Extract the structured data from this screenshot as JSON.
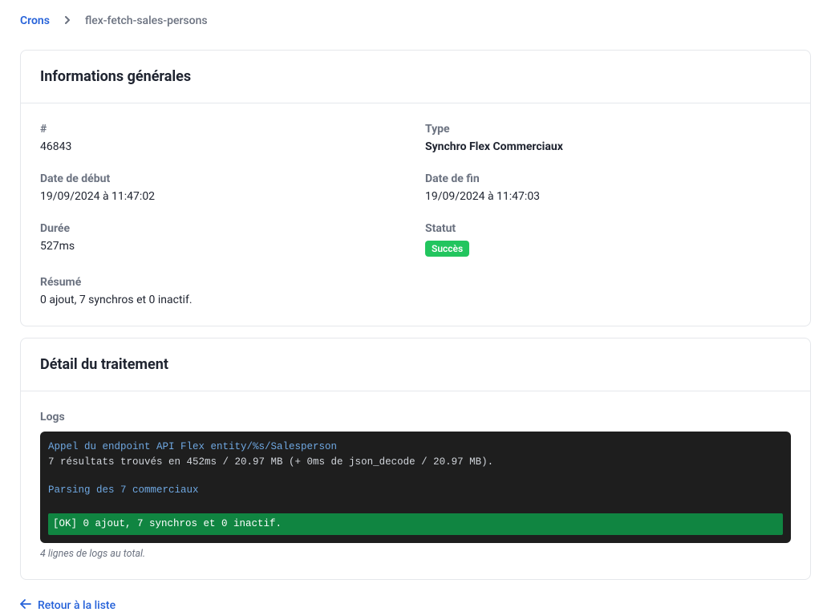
{
  "breadcrumb": {
    "root": "Crons",
    "current": "flex-fetch-sales-persons"
  },
  "card_general": {
    "title": "Informations générales",
    "fields": {
      "id_label": "#",
      "id_value": "46843",
      "type_label": "Type",
      "type_value": "Synchro Flex Commerciaux",
      "start_label": "Date de début",
      "start_value": "19/09/2024 à 11:47:02",
      "end_label": "Date de fin",
      "end_value": "19/09/2024 à 11:47:03",
      "duration_label": "Durée",
      "duration_value": "527ms",
      "status_label": "Statut",
      "status_value": "Succès",
      "summary_label": "Résumé",
      "summary_value": "0 ajout, 7 synchros et 0 inactif."
    }
  },
  "card_detail": {
    "title": "Détail du traitement",
    "logs_label": "Logs",
    "log_lines": [
      {
        "cls": "log-info",
        "text": "Appel du endpoint API Flex entity/%s/Salesperson"
      },
      {
        "cls": "log-plain",
        "text": "7 résultats trouvés en 452ms / 20.97 MB (+ 0ms de json_decode / 20.97 MB)."
      },
      {
        "cls": "log-blank",
        "text": ""
      },
      {
        "cls": "log-info",
        "text": "Parsing des 7 commerciaux"
      },
      {
        "cls": "log-blank",
        "text": ""
      },
      {
        "cls": "log-ok",
        "text": "[OK] 0 ajout, 7 synchros et 0 inactif."
      }
    ],
    "logs_footer": "4 lignes de logs au total."
  },
  "back_link": "Retour à la liste"
}
